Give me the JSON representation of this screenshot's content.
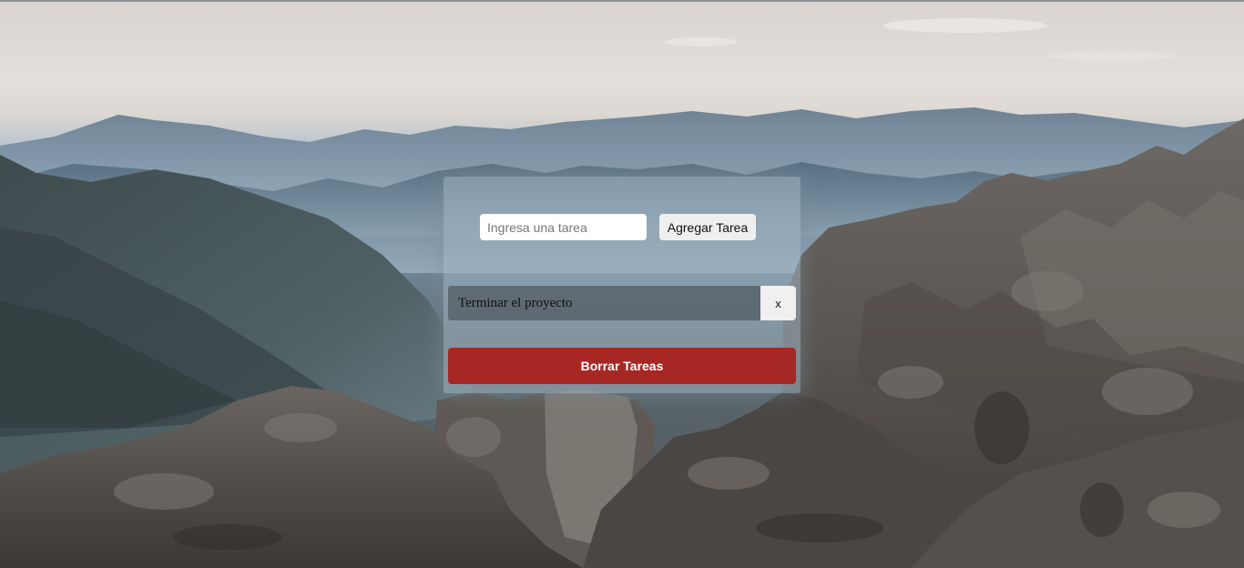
{
  "form": {
    "input_placeholder": "Ingresa una tarea",
    "input_value": "",
    "add_button_label": "Agregar Tarea"
  },
  "tasks": [
    {
      "text": "Terminar el proyecto",
      "delete_label": "x"
    }
  ],
  "clear_button": {
    "label": "Borrar Tareas",
    "color": "#a72725"
  },
  "background": {
    "icon": "mountain-landscape-image"
  }
}
